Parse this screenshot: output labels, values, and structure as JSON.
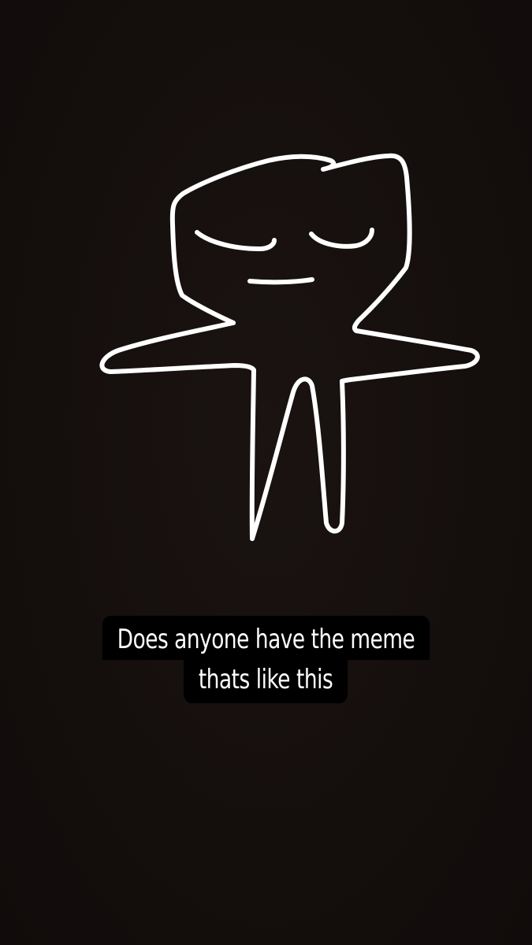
{
  "story": {
    "caption_lines": [
      "Does anyone have the meme",
      "thats like this"
    ],
    "drawing": "stick-figure-doodle",
    "colors": {
      "background": "#150f0e",
      "stroke": "#ffffff",
      "caption_bg": "#000000",
      "caption_text": "#ffffff"
    }
  }
}
